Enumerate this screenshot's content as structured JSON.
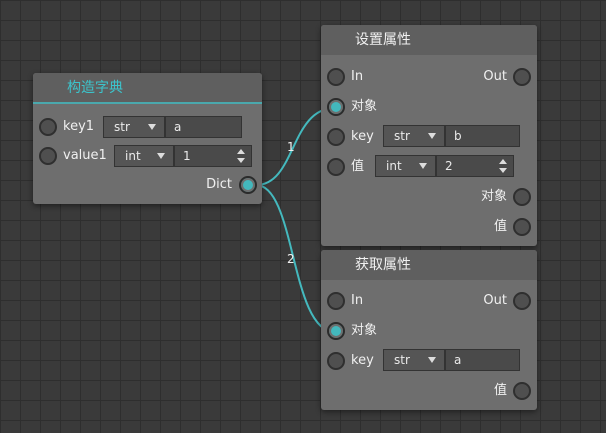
{
  "nodes": {
    "make_dict": {
      "title": "构造字典",
      "rows": [
        {
          "label": "key1",
          "type": "str",
          "value": "a"
        },
        {
          "label": "value1",
          "type": "int",
          "value": "1"
        }
      ],
      "output_label": "Dict"
    },
    "set_attr": {
      "title": "设置属性",
      "in_label": "In",
      "out_label": "Out",
      "object_label": "对象",
      "key_label": "key",
      "key_type": "str",
      "key_value": "b",
      "value_label": "值",
      "value_type": "int",
      "value_value": "2",
      "out_object_label": "对象",
      "out_value_label": "值"
    },
    "get_attr": {
      "title": "获取属性",
      "in_label": "In",
      "out_label": "Out",
      "object_label": "对象",
      "key_label": "key",
      "key_type": "str",
      "key_value": "a",
      "out_value_label": "值"
    }
  },
  "connections": [
    {
      "label": "1",
      "from": "Dict",
      "to": "设置属性.对象"
    },
    {
      "label": "2",
      "from": "Dict",
      "to": "获取属性.对象"
    }
  ],
  "colors": {
    "wire": "#44b9be",
    "accent_title": "#3cc4cc",
    "node_body": "#6e6e6e",
    "canvas": "#3a3a3a"
  }
}
